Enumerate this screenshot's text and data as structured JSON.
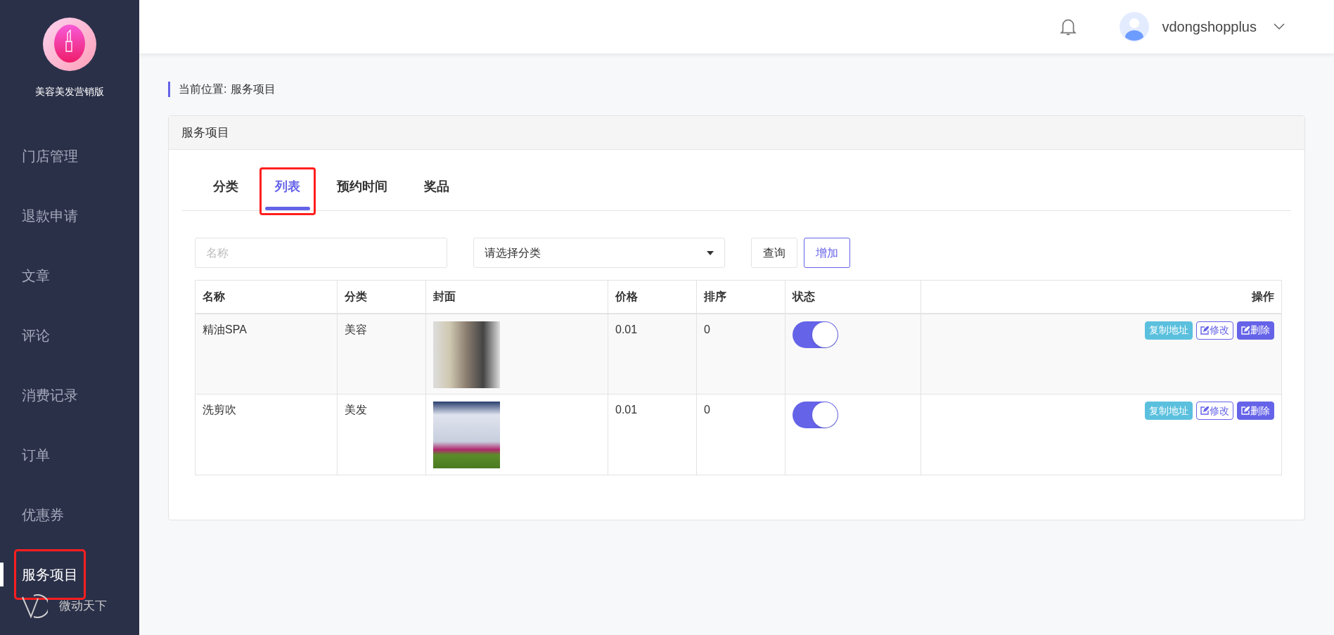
{
  "sidebar": {
    "brand": "美容美发营销版",
    "items": [
      {
        "label": "门店管理",
        "selected": false,
        "highlighted": false
      },
      {
        "label": "退款申请",
        "selected": false,
        "highlighted": false
      },
      {
        "label": "文章",
        "selected": false,
        "highlighted": false
      },
      {
        "label": "评论",
        "selected": false,
        "highlighted": false
      },
      {
        "label": "消费记录",
        "selected": false,
        "highlighted": false
      },
      {
        "label": "订单",
        "selected": false,
        "highlighted": false
      },
      {
        "label": "优惠券",
        "selected": false,
        "highlighted": false
      },
      {
        "label": "服务项目",
        "selected": true,
        "highlighted": true
      }
    ],
    "footer": "微动天下"
  },
  "header": {
    "username": "vdongshopplus"
  },
  "breadcrumb": {
    "label": "当前位置:",
    "current": "服务项目"
  },
  "panel": {
    "title": "服务项目",
    "tabs": [
      {
        "label": "分类",
        "selected": false,
        "highlighted": false
      },
      {
        "label": "列表",
        "selected": true,
        "highlighted": true
      },
      {
        "label": "预约时间",
        "selected": false,
        "highlighted": false
      },
      {
        "label": "奖品",
        "selected": false,
        "highlighted": false
      }
    ],
    "filters": {
      "name": {
        "placeholder": "名称"
      },
      "category": {
        "value": "请选择分类"
      },
      "buttons": [
        {
          "label": "查询",
          "kind": "plain"
        },
        {
          "label": "增加",
          "kind": "outline"
        }
      ]
    },
    "table": {
      "columns": [
        "名称",
        "分类",
        "封面",
        "价格",
        "排序",
        "状态",
        "操作"
      ],
      "rows": [
        {
          "name": "精油SPA",
          "category": "美容",
          "cover": {
            "kind": "people"
          },
          "price": "0.01",
          "sort": "0",
          "on": true,
          "actions": [
            {
              "label": "复制地址",
              "kind": "copy"
            },
            {
              "label": "修改",
              "kind": "edit"
            },
            {
              "label": "删除",
              "kind": "delete"
            }
          ]
        },
        {
          "name": "洗剪吹",
          "category": "美发",
          "cover": {
            "kind": "landscape"
          },
          "price": "0.01",
          "sort": "0",
          "on": true,
          "actions": [
            {
              "label": "复制地址",
              "kind": "copy"
            },
            {
              "label": "修改",
              "kind": "edit"
            },
            {
              "label": "删除",
              "kind": "delete"
            }
          ]
        }
      ]
    }
  }
}
